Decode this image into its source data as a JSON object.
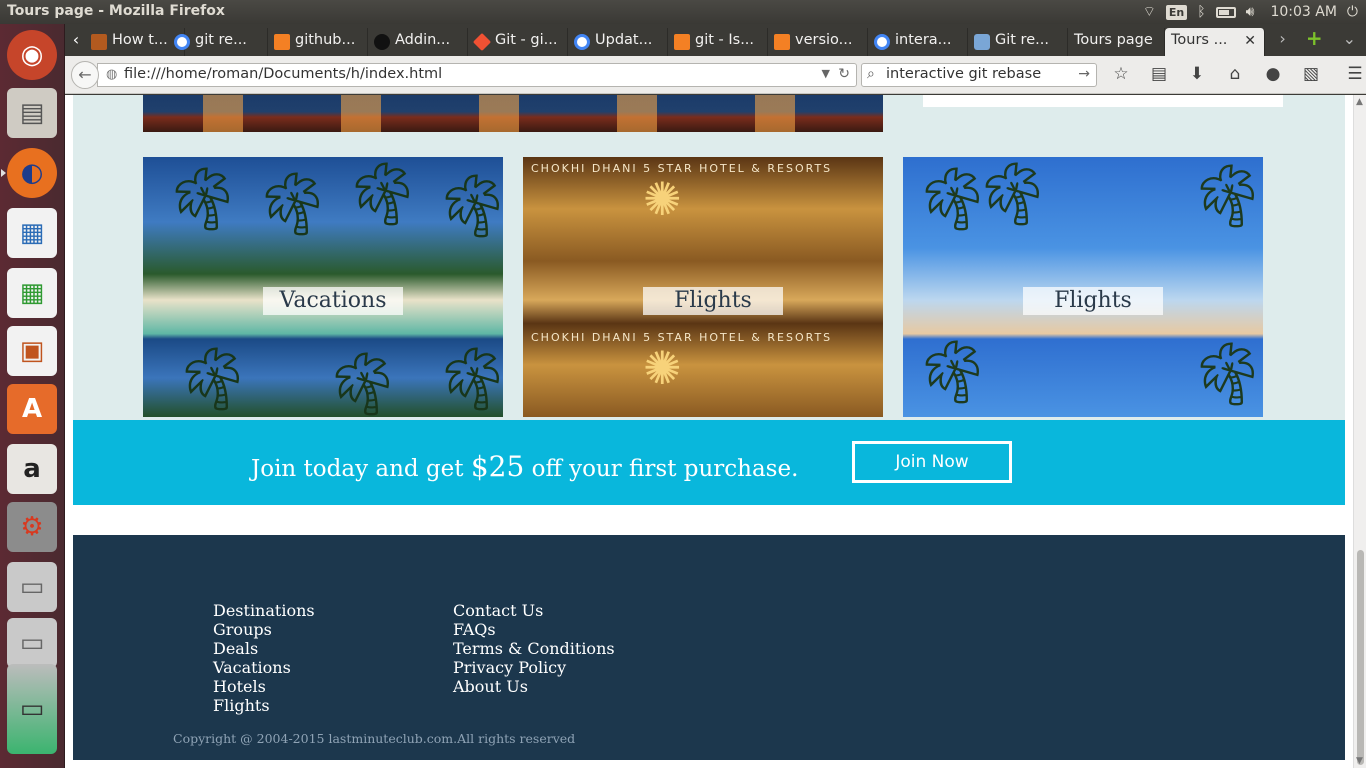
{
  "window": {
    "title": "Tours page - Mozilla Firefox"
  },
  "panel": {
    "keyboard": "En",
    "clock": "10:03 AM"
  },
  "launcher": {
    "items": [
      {
        "name": "ubuntu-dash-icon",
        "glyph": "◉"
      },
      {
        "name": "files-icon",
        "glyph": "▤"
      },
      {
        "name": "firefox-icon",
        "glyph": "◐"
      },
      {
        "name": "writer-icon",
        "glyph": "▦"
      },
      {
        "name": "calc-icon",
        "glyph": "▦"
      },
      {
        "name": "impress-icon",
        "glyph": "▣"
      },
      {
        "name": "software-center-icon",
        "glyph": "A"
      },
      {
        "name": "amazon-icon",
        "glyph": "a"
      },
      {
        "name": "system-settings-icon",
        "glyph": "⚙"
      },
      {
        "name": "drive-icon",
        "glyph": "▭"
      },
      {
        "name": "drive-icon",
        "glyph": "▭"
      },
      {
        "name": "drive-stack-icon",
        "glyph": "▭"
      }
    ]
  },
  "tabs": [
    {
      "label": "How t...",
      "fav": "#b35a1f"
    },
    {
      "label": "git re...",
      "fav": "#4285f4"
    },
    {
      "label": "github...",
      "fav": "#f48024"
    },
    {
      "label": "Addin...",
      "fav": "#222222"
    },
    {
      "label": "Git - gi...",
      "fav": "#f05133"
    },
    {
      "label": "Updat...",
      "fav": "#4285f4"
    },
    {
      "label": "git - Is...",
      "fav": "#f48024"
    },
    {
      "label": "versio...",
      "fav": "#f48024"
    },
    {
      "label": "intera...",
      "fav": "#4285f4"
    },
    {
      "label": "Git re...",
      "fav": "#7aa6d6"
    },
    {
      "label": "Tours page",
      "fav": ""
    },
    {
      "label": "Tours ...",
      "fav": "",
      "active": true
    }
  ],
  "navbar": {
    "url": "file:///home/roman/Documents/h/index.html",
    "search": "interactive git rebase"
  },
  "page": {
    "tours": [
      {
        "label": "Vacations"
      },
      {
        "label": "Flights",
        "overlay_text": "CHOKHI DHANI 5 STAR HOTEL & RESORTS"
      },
      {
        "label": "Flights"
      }
    ],
    "promo": {
      "text_before": "Join today and get ",
      "amount": "$25",
      "text_after": " off your first purchase.",
      "button": "Join Now"
    },
    "footer": {
      "col1": [
        "Destinations",
        "Groups",
        "Deals",
        "Vacations",
        "Hotels",
        "Flights"
      ],
      "col2": [
        "Contact Us",
        "FAQs",
        "Terms & Conditions",
        "Privacy Policy",
        "About Us"
      ],
      "copyright": "Copyright @ 2004-2015 lastminuteclub.com.All rights reserved"
    }
  },
  "colors": {
    "promo_bg": "#09b7dc",
    "footer_bg": "#1c374d",
    "tours_bg": "#deecec"
  }
}
